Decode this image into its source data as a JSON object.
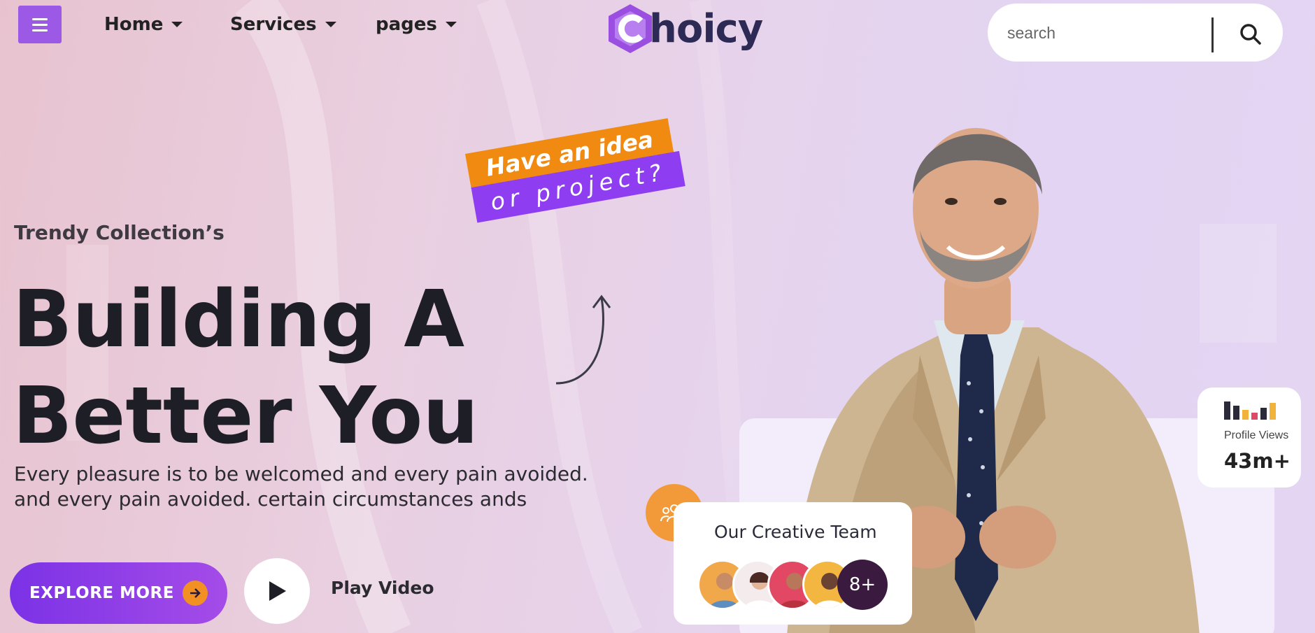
{
  "nav": {
    "items": [
      {
        "label": "Home"
      },
      {
        "label": "Services"
      },
      {
        "label": "pages"
      }
    ]
  },
  "logo": {
    "text": "hoicy",
    "letter": "C"
  },
  "search": {
    "placeholder": "search"
  },
  "hero": {
    "eyebrow": "Trendy Collection’s",
    "headline_line1": "Building A",
    "headline_line2": "Better You",
    "description_line1": "Every pleasure is to be welcomed and every pain avoided.",
    "description_line2": "and every pain avoided. certain circumstances ands",
    "badge_line1": "Have an idea",
    "badge_line2": "or project?",
    "explore_label": "EXPLORE MORE",
    "play_label": "Play Video"
  },
  "team_card": {
    "title": "Our Creative Team",
    "more_count": "8+"
  },
  "views_card": {
    "label": "Profile Views",
    "value": "43m+"
  },
  "colors": {
    "accent_purple": "#9b59e6",
    "accent_orange": "#f08a10",
    "text_dark": "#1e1e26"
  }
}
